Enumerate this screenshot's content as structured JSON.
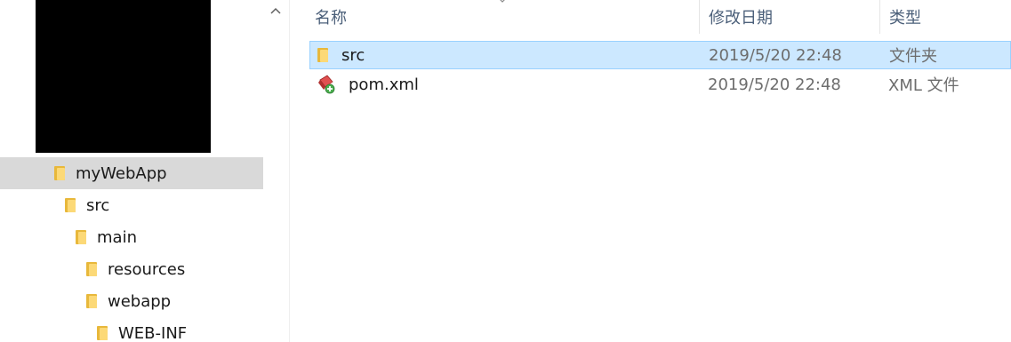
{
  "nav_tree": {
    "items": [
      {
        "label": "myWebApp",
        "selected": true
      },
      {
        "label": "src",
        "selected": false
      },
      {
        "label": "main",
        "selected": false
      },
      {
        "label": "resources",
        "selected": false
      },
      {
        "label": "webapp",
        "selected": false
      },
      {
        "label": "WEB-INF",
        "selected": false
      }
    ]
  },
  "columns": {
    "name": "名称",
    "date_modified": "修改日期",
    "type": "类型"
  },
  "files": [
    {
      "name": "src",
      "date_modified": "2019/5/20 22:48",
      "type": "文件夹",
      "icon": "folder-icon",
      "selected": true
    },
    {
      "name": "pom.xml",
      "date_modified": "2019/5/20 22:48",
      "type": "XML 文件",
      "icon": "xml-file-icon",
      "selected": false
    }
  ],
  "colors": {
    "selection_fill": "#cce8ff",
    "selection_border": "#99d1ff",
    "nav_selected": "#d9d9d9",
    "header_text": "#4c607a",
    "folder_yellow": "#fcd977"
  }
}
